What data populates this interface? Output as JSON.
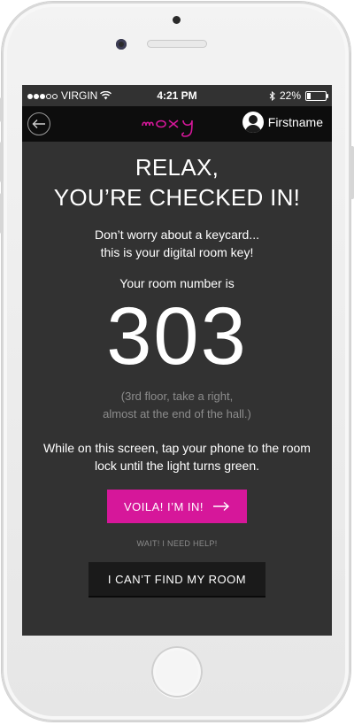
{
  "status_bar": {
    "carrier": "VIRGIN",
    "time": "4:21 PM",
    "battery": "22%",
    "signal_icon": "signal-dots-icon",
    "wifi_icon": "wifi-icon",
    "bluetooth_icon": "bluetooth-icon"
  },
  "nav": {
    "back_icon": "back-arrow-icon",
    "logo": "moxy",
    "user_name": "Firstname",
    "avatar_icon": "user-avatar-icon"
  },
  "content": {
    "title_line1": "RELAX,",
    "title_line2": "YOU’RE CHECKED IN!",
    "subtitle_line1": "Don’t worry about a keycard...",
    "subtitle_line2": "this is your digital room key!",
    "room_label": "Your room number is",
    "room_number": "303",
    "directions_line1": "(3rd floor, take a right,",
    "directions_line2": "almost at the end of the hall.)",
    "instructions": "While on this screen, tap your phone to the room lock until the light turns green.",
    "voila_button": "VOILA! I’M IN!",
    "help_link": "WAIT! I NEED HELP!",
    "find_room_button": "I CAN’T FIND MY ROOM"
  },
  "colors": {
    "accent": "#d6179a",
    "screen_bg": "#323232",
    "navbar_bg": "#0d0d0d"
  }
}
